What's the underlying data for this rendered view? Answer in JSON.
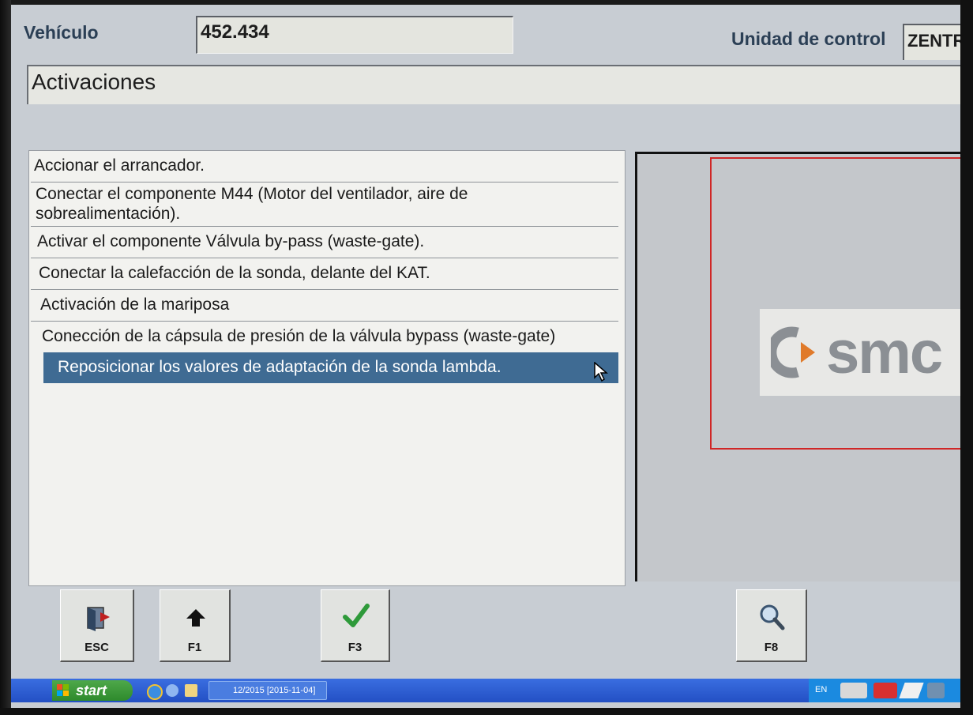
{
  "header": {
    "vehicle_label": "Vehículo",
    "vehicle_value": "452.434",
    "control_unit_label": "Unidad de control",
    "control_unit_value": "ZENTR"
  },
  "title": "Activaciones",
  "list": {
    "items": [
      "Accionar el arrancador.",
      "Conectar el componente M44 (Motor del ventilador, aire de sobrealimentación).",
      "Activar el componente Válvula by-pass (waste-gate).",
      "Conectar la calefacción de la sonda, delante del KAT.",
      "Activación de la mariposa",
      "Conección de la cápsula de presión de la válvula bypass (waste-gate)",
      "Reposicionar los valores de adaptación de la sonda lambda."
    ],
    "selected_index": 6
  },
  "logo_text": "smc",
  "function_keys": {
    "esc_label": "ESC",
    "f1_label": "F1",
    "f3_label": "F3",
    "f8_label": "F8"
  },
  "taskbar": {
    "start_label": "start",
    "task_label": "12/2015 [2015-11-04]",
    "language": "EN"
  },
  "colors": {
    "selection": "#3f6b93",
    "accent_frame": "#d02626",
    "check_green": "#2e9a3a"
  }
}
